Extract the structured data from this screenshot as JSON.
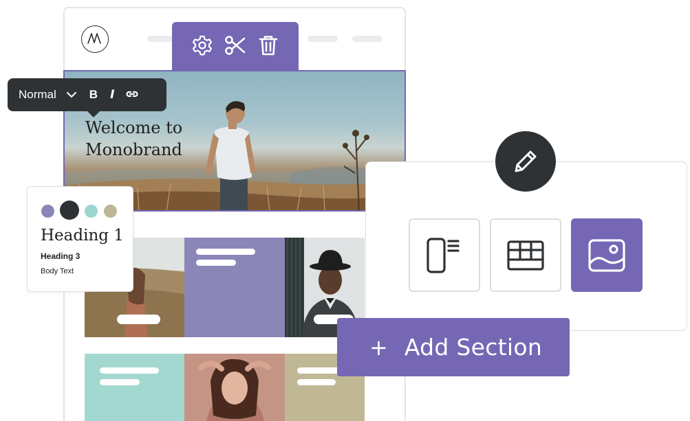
{
  "toolbar_icons": [
    "gear-icon",
    "scissors-icon",
    "trash-icon"
  ],
  "hero": {
    "title_line1": "Welcome to",
    "title_line2": "Monobrand"
  },
  "format_toolbar": {
    "style_value": "Normal",
    "bold_label": "B",
    "italic_label": "I",
    "link_icon": "link-icon"
  },
  "style_card": {
    "swatches": [
      "#8a86b8",
      "#2f3234",
      "#9bd6d0",
      "#bdb692"
    ],
    "heading1": "Heading 1",
    "heading3": "Heading 3",
    "body": "Body Text"
  },
  "section_picker": {
    "options": [
      "sidebar-layout-icon",
      "grid-layout-icon",
      "image-layout-icon"
    ],
    "selected": "image-layout-icon"
  },
  "add_section": {
    "plus": "+",
    "label": "Add Section"
  },
  "colors": {
    "accent": "#7567b4",
    "dark": "#2f3234",
    "tile_purple": "#8a86b8",
    "tile_mint": "#a3d8d0",
    "tile_khaki": "#c0b895"
  }
}
